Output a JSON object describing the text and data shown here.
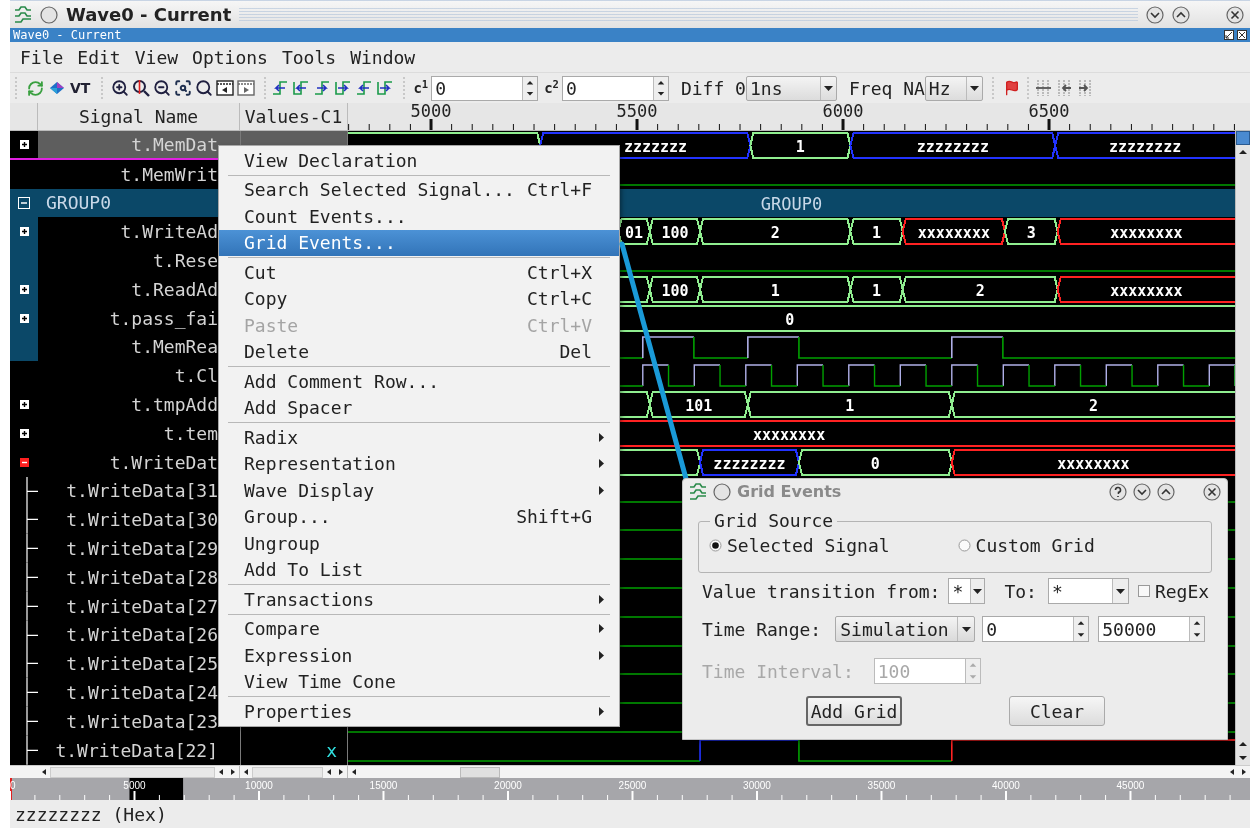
{
  "window": {
    "title": "Wave0 - Current",
    "subtitle": "Wave0 - Current"
  },
  "menu_bar": [
    "File",
    "Edit",
    "View",
    "Options",
    "Tools",
    "Window"
  ],
  "toolbar": {
    "vt_label": "VT",
    "c1_label": "c$^{1}$",
    "c1_value": "0",
    "c2_label": "c$^{2}$",
    "c2_value": "0",
    "diff_label": "Diff 0",
    "diff_unit": "1ns",
    "freq_label": "Freq NA",
    "freq_unit": "Hz"
  },
  "columns": {
    "signal_name": "Signal Name",
    "values": "Values-C1"
  },
  "timeline": {
    "ticks": [
      "5000",
      "5500",
      "6000",
      "6500"
    ]
  },
  "signals": [
    {
      "name": "t.MemDat",
      "kind": "bus",
      "selected": true,
      "expanded": false,
      "values": [
        {
          "label": "zzzzzzz",
          "color": "#2233ff"
        },
        {
          "label": "1",
          "color": "#90ee90"
        },
        {
          "label": "zzzzzzzz",
          "color": "#2233ff"
        },
        {
          "label": "zzzzzzzz",
          "color": "#2233ff"
        }
      ]
    },
    {
      "name": "t.MemWrit",
      "kind": "scalar",
      "selected": false
    },
    {
      "name": "GROUP0",
      "kind": "group",
      "selected": false,
      "expanded": true,
      "wave_label": "GROUP0",
      "children": [
        {
          "name": "t.WriteAd",
          "kind": "bus",
          "selected": false,
          "expanded": false,
          "values": [
            {
              "label": "01",
              "color": "#90ee90"
            },
            {
              "label": "100",
              "color": "#90ee90"
            },
            {
              "label": "2",
              "color": "#90ee90"
            },
            {
              "label": "1",
              "color": "#90ee90"
            },
            {
              "label": "xxxxxxxx",
              "color": "#ff2222"
            },
            {
              "label": "3",
              "color": "#90ee90"
            },
            {
              "label": "xxxxxxxx",
              "color": "#ff2222"
            }
          ]
        },
        {
          "name": "t.Rese",
          "kind": "scalar",
          "selected": false
        },
        {
          "name": "t.ReadAd",
          "kind": "bus",
          "selected": false,
          "expanded": false,
          "values": [
            {
              "label": "100",
              "color": "#90ee90"
            },
            {
              "label": "1",
              "color": "#90ee90"
            },
            {
              "label": "1",
              "color": "#90ee90"
            },
            {
              "label": "2",
              "color": "#90ee90"
            },
            {
              "label": "xxxxxxxx",
              "color": "#ff2222"
            }
          ]
        },
        {
          "name": "t.pass_fai",
          "kind": "bus",
          "selected": false,
          "expanded": false,
          "values": [
            {
              "label": "0",
              "color": "#90ee90"
            }
          ]
        },
        {
          "name": "t.MemRea",
          "kind": "scalar",
          "selected": false
        }
      ]
    },
    {
      "name": "t.Cl",
      "kind": "clock",
      "selected": false
    },
    {
      "name": "t.tmpAdd",
      "kind": "bus",
      "selected": false,
      "expanded": false,
      "values": [
        {
          "label": "101",
          "color": "#90ee90"
        },
        {
          "label": "1",
          "color": "#90ee90"
        },
        {
          "label": "2",
          "color": "#90ee90"
        }
      ]
    },
    {
      "name": "t.tem",
      "kind": "bus",
      "selected": false,
      "expanded": false,
      "values": [
        {
          "label": "xxxxxxxx",
          "color": "#ff2222"
        }
      ]
    },
    {
      "name": "t.WriteDat",
      "kind": "bus",
      "selected": false,
      "expanded": true,
      "values": [
        {
          "label": "zzzzzzzz",
          "color": "#2233ff"
        },
        {
          "label": "0",
          "color": "#90ee90"
        },
        {
          "label": "xxxxxxxx",
          "color": "#ff2222"
        }
      ],
      "children": [
        {
          "name": "t.WriteData[31",
          "kind": "scalar",
          "selected": false
        },
        {
          "name": "t.WriteData[30",
          "kind": "scalar",
          "selected": false
        },
        {
          "name": "t.WriteData[29",
          "kind": "scalar",
          "selected": false
        },
        {
          "name": "t.WriteData[28",
          "kind": "scalar",
          "selected": false
        },
        {
          "name": "t.WriteData[27",
          "kind": "scalar",
          "selected": false
        },
        {
          "name": "t.WriteData[26",
          "kind": "scalar",
          "selected": false
        },
        {
          "name": "t.WriteData[25",
          "kind": "scalar",
          "selected": false
        },
        {
          "name": "t.WriteData[24",
          "kind": "scalar",
          "selected": false
        },
        {
          "name": "t.WriteData[23",
          "kind": "scalar",
          "selected": false
        },
        {
          "name": "t.WriteData[22]",
          "kind": "scalar",
          "selected": false,
          "value": "x"
        }
      ]
    }
  ],
  "context_menu": {
    "items": [
      {
        "kind": "item",
        "label": "View Declaration",
        "selected": false,
        "disabled": false,
        "submenu": false
      },
      {
        "kind": "separator"
      },
      {
        "kind": "item",
        "label": "Search Selected Signal...",
        "shortcut": "Ctrl+F",
        "selected": false,
        "disabled": false,
        "submenu": false
      },
      {
        "kind": "item",
        "label": "Count Events...",
        "selected": false,
        "disabled": false,
        "submenu": false
      },
      {
        "kind": "item",
        "label": "Grid Events...",
        "selected": true,
        "disabled": false,
        "submenu": false
      },
      {
        "kind": "separator"
      },
      {
        "kind": "item",
        "label": "Cut",
        "shortcut": "Ctrl+X",
        "selected": false,
        "disabled": false,
        "submenu": false
      },
      {
        "kind": "item",
        "label": "Copy",
        "shortcut": "Ctrl+C",
        "selected": false,
        "disabled": false,
        "submenu": false
      },
      {
        "kind": "item",
        "label": "Paste",
        "shortcut": "Ctrl+V",
        "selected": false,
        "disabled": true,
        "submenu": false
      },
      {
        "kind": "item",
        "label": "Delete",
        "shortcut": "Del",
        "selected": false,
        "disabled": false,
        "submenu": false
      },
      {
        "kind": "separator"
      },
      {
        "kind": "item",
        "label": "Add Comment Row...",
        "selected": false,
        "disabled": false,
        "submenu": false
      },
      {
        "kind": "item",
        "label": "Add Spacer",
        "selected": false,
        "disabled": false,
        "submenu": false
      },
      {
        "kind": "separator"
      },
      {
        "kind": "item",
        "label": "Radix",
        "selected": false,
        "disabled": false,
        "submenu": true
      },
      {
        "kind": "item",
        "label": "Representation",
        "selected": false,
        "disabled": false,
        "submenu": true
      },
      {
        "kind": "item",
        "label": "Wave Display",
        "selected": false,
        "disabled": false,
        "submenu": true
      },
      {
        "kind": "item",
        "label": "Group...",
        "shortcut": "Shift+G",
        "selected": false,
        "disabled": false,
        "submenu": false
      },
      {
        "kind": "item",
        "label": "Ungroup",
        "selected": false,
        "disabled": false,
        "submenu": false
      },
      {
        "kind": "item",
        "label": "Add To List",
        "selected": false,
        "disabled": false,
        "submenu": false
      },
      {
        "kind": "separator"
      },
      {
        "kind": "item",
        "label": "Transactions",
        "selected": false,
        "disabled": false,
        "submenu": true
      },
      {
        "kind": "separator"
      },
      {
        "kind": "item",
        "label": "Compare",
        "selected": false,
        "disabled": false,
        "submenu": true
      },
      {
        "kind": "item",
        "label": "Expression",
        "selected": false,
        "disabled": false,
        "submenu": true
      },
      {
        "kind": "item",
        "label": "View Time Cone",
        "selected": false,
        "disabled": false,
        "submenu": false
      },
      {
        "kind": "separator"
      },
      {
        "kind": "item",
        "label": "Properties",
        "selected": false,
        "disabled": false,
        "submenu": true
      }
    ]
  },
  "dialog": {
    "title": "Grid Events",
    "grid_source": {
      "title": "Grid Source",
      "options": [
        {
          "label": "Selected Signal",
          "selected": true
        },
        {
          "label": "Custom Grid",
          "selected": false
        }
      ]
    },
    "transition": {
      "from_label": "Value transition from:",
      "from_value": "*",
      "to_label": "To:",
      "to_value": "*",
      "regex": {
        "label": "RegEx",
        "checked": false
      }
    },
    "time_range": {
      "label": "Time Range:",
      "mode": "Simulation",
      "start": "0",
      "end": "50000"
    },
    "time_interval": {
      "label": "Time Interval:",
      "value": "100",
      "disabled": true
    },
    "buttons": [
      {
        "label": "Add Grid",
        "default": true
      },
      {
        "label": "Clear",
        "default": false
      }
    ]
  },
  "overview": {
    "labels": [
      "0",
      "5000",
      "10000",
      "15000",
      "20000",
      "25000",
      "30000",
      "35000",
      "40000",
      "45000"
    ]
  },
  "status_bar": "zzzzzzzz (Hex)"
}
